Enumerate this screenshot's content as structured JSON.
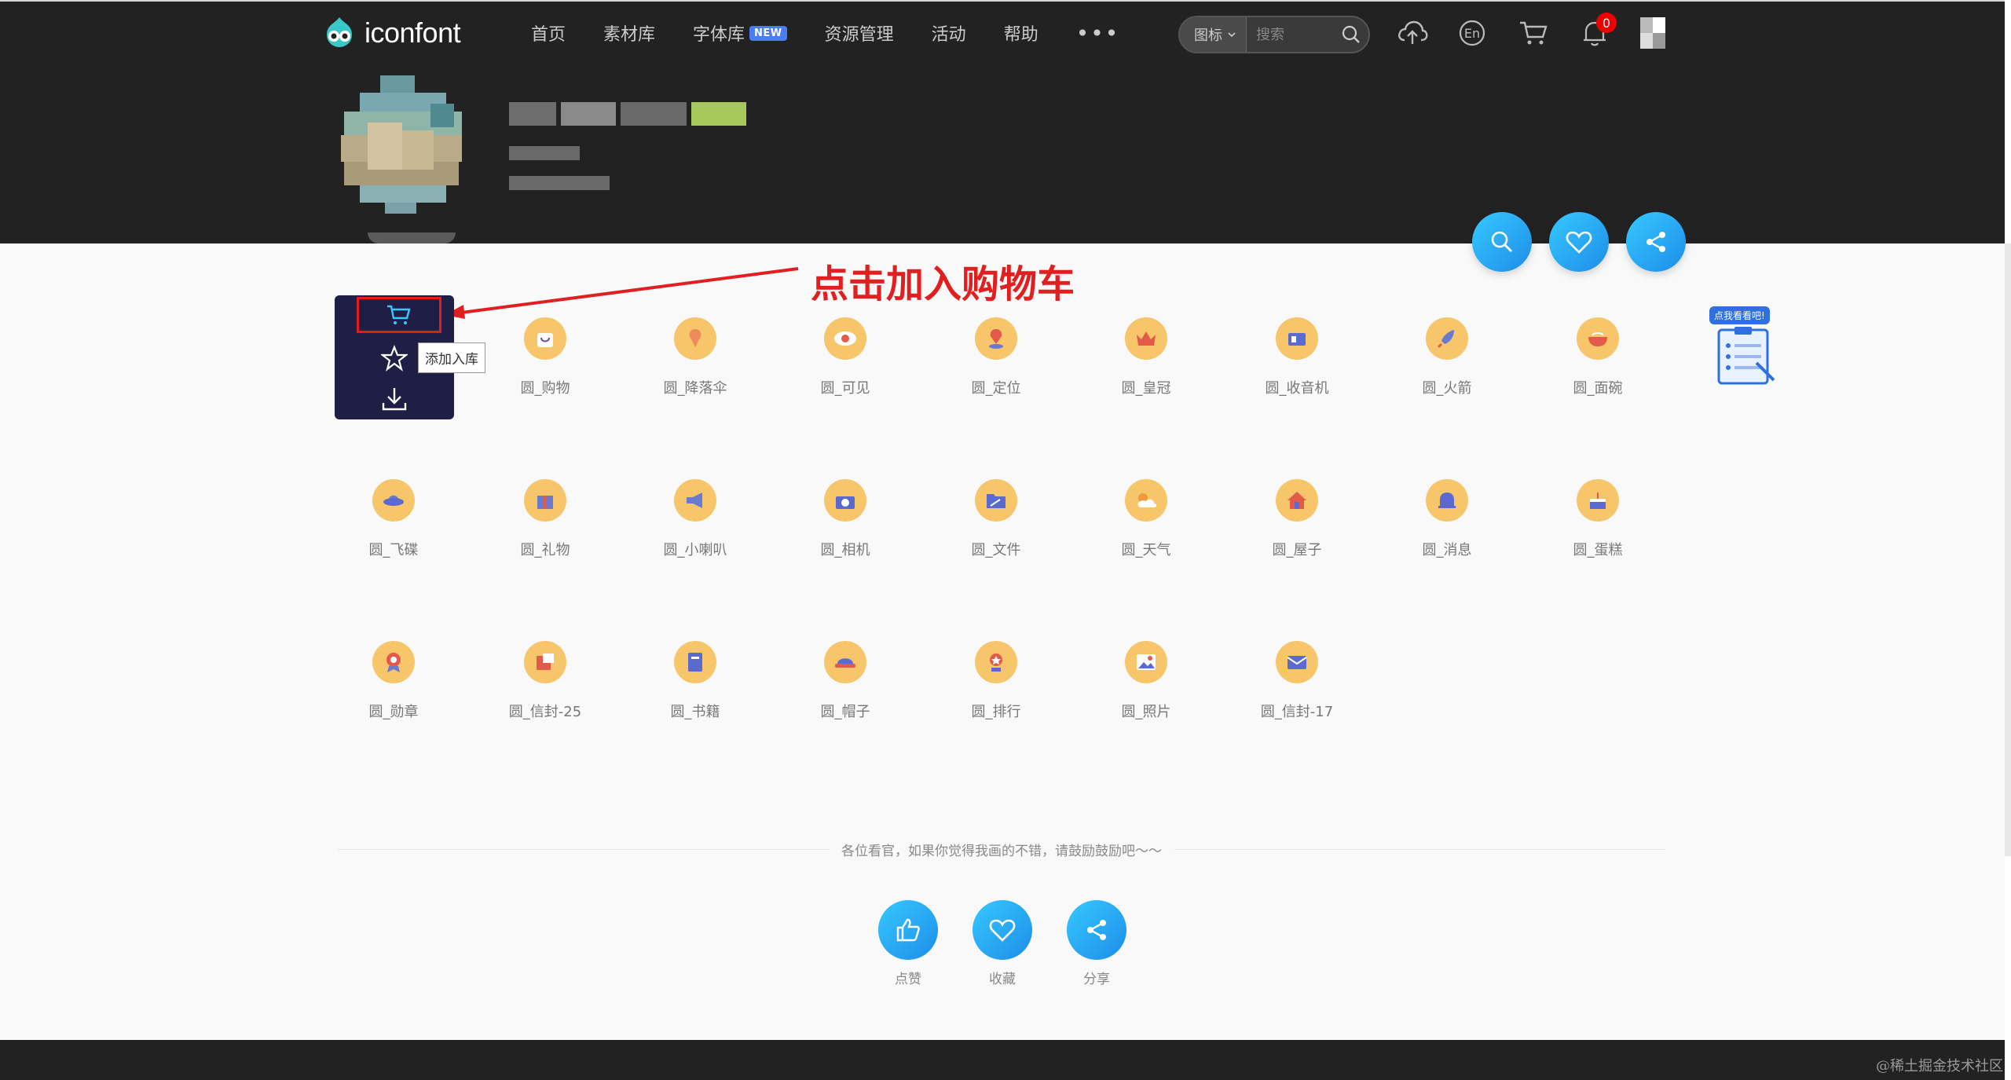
{
  "brand": {
    "logo_text": "iconfont"
  },
  "nav": {
    "items": [
      {
        "label": "首页"
      },
      {
        "label": "素材库"
      },
      {
        "label": "字体库",
        "badge": "NEW"
      },
      {
        "label": "资源管理"
      },
      {
        "label": "活动"
      },
      {
        "label": "帮助"
      }
    ],
    "more_label": "•••"
  },
  "search": {
    "type_label": "图标",
    "placeholder": "搜索"
  },
  "top_icons": {
    "lang_label": "En",
    "notification_count": "0"
  },
  "annotation": {
    "text": "点击加入购物车"
  },
  "popup": {
    "tooltip": "添加入库"
  },
  "icons": [
    {
      "label": "圆_购物"
    },
    {
      "label": "圆_降落伞"
    },
    {
      "label": "圆_可见"
    },
    {
      "label": "圆_定位"
    },
    {
      "label": "圆_皇冠"
    },
    {
      "label": "圆_收音机"
    },
    {
      "label": "圆_火箭"
    },
    {
      "label": "圆_面碗"
    },
    {
      "label": "圆_飞碟"
    },
    {
      "label": "圆_礼物"
    },
    {
      "label": "圆_小喇叭"
    },
    {
      "label": "圆_相机"
    },
    {
      "label": "圆_文件"
    },
    {
      "label": "圆_天气"
    },
    {
      "label": "圆_屋子"
    },
    {
      "label": "圆_消息"
    },
    {
      "label": "圆_蛋糕"
    },
    {
      "label": "圆_勋章"
    },
    {
      "label": "圆_信封-25"
    },
    {
      "label": "圆_书籍"
    },
    {
      "label": "圆_帽子"
    },
    {
      "label": "圆_排行"
    },
    {
      "label": "圆_照片"
    },
    {
      "label": "圆_信封-17"
    }
  ],
  "side_banner": {
    "tag": "点我看看吧!"
  },
  "encourage": {
    "text": "各位看官，如果你觉得我画的不错，请鼓励鼓励吧～～"
  },
  "actions": [
    {
      "label": "点赞"
    },
    {
      "label": "收藏"
    },
    {
      "label": "分享"
    }
  ],
  "watermark": "@稀土掘金技术社区",
  "colors": {
    "header_bg": "#222222",
    "accent_blue": "#1e8de8",
    "icon_orange": "#f7c56a",
    "annotation_red": "#e02020",
    "badge_red": "#ee0000"
  }
}
